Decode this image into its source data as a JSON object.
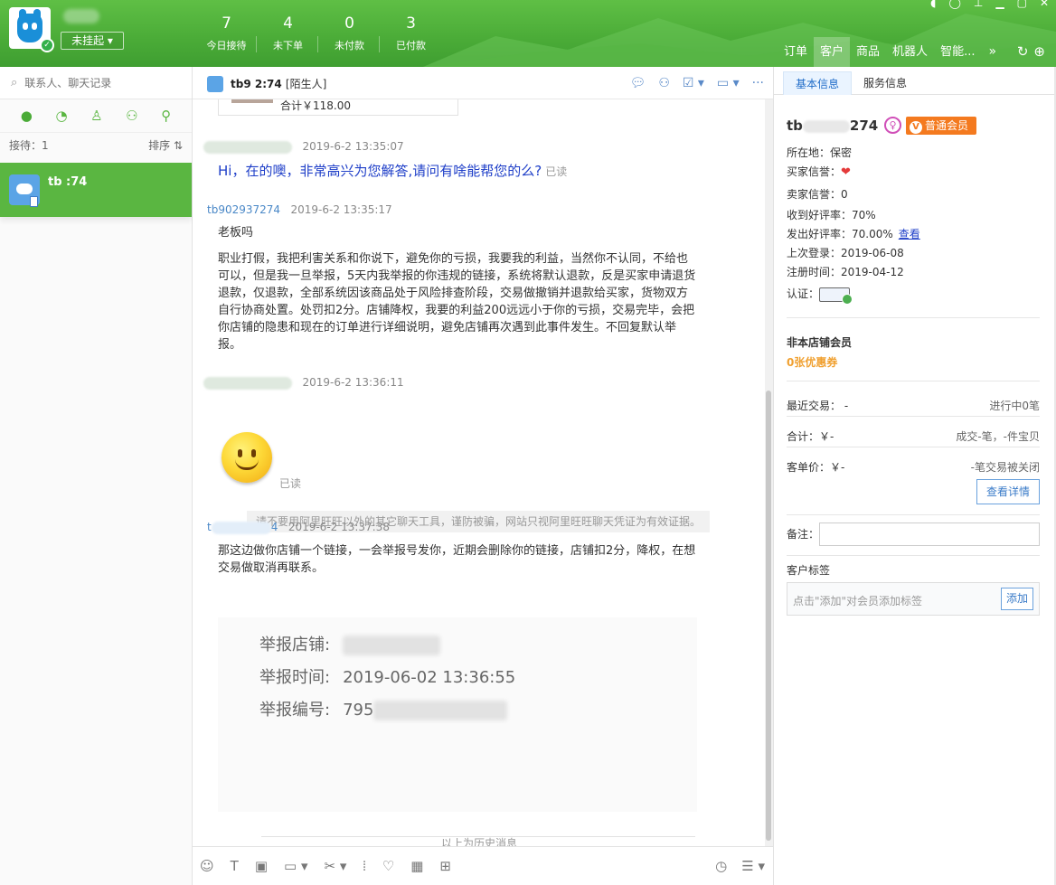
{
  "header": {
    "status": "未挂起",
    "stats": [
      {
        "num": "7",
        "label": "今日接待"
      },
      {
        "num": "4",
        "label": "未下单"
      },
      {
        "num": "0",
        "label": "未付款"
      },
      {
        "num": "3",
        "label": "已付款"
      }
    ],
    "nav_tabs": [
      "订单",
      "客户",
      "商品",
      "机器人",
      "智能..."
    ],
    "nav_more": "»"
  },
  "left": {
    "search_placeholder": "联系人、聊天记录",
    "reception_label": "接待：1",
    "sort_label": "排序 ⇅",
    "contact_name": "tb          :74"
  },
  "chat": {
    "header_name": "tb9        2:74",
    "header_tag": "[陌生人]",
    "order_total": "合计￥118.00",
    "messages": {
      "m1_time": "2019-6-2 13:35:07",
      "m1_text": "Hi，在的噢，非常高兴为您解答,请问有啥能帮您的么?",
      "read": "已读",
      "m2_sender": "tb902937274",
      "m2_time": "2019-6-2 13:35:17",
      "m2_text1": "老板吗",
      "m2_text2": "职业打假，我把利害关系和你说下，避免你的亏损，我要我的利益，当然你不认同，不给也可以，但是我一旦举报，5天内我举报的你违规的链接，系统将默认退款，反是买家申请退货退款，仅退款，全部系统因该商品处于风险排查阶段，交易做撤销并退款给买家，货物双方自行协商处置。处罚扣2分。店铺降权，我要的利益200远远小于你的亏损，交易完毕，会把你店铺的隐患和现在的订单进行详细说明，避免店铺再次遇到此事件发生。不回复默认举报。",
      "m3_time": "2019-6-2 13:36:11",
      "notice": "请不要用阿里旺旺以外的其它聊天工具，谨防被骗，网站只视阿里旺旺聊天凭证为有效证据。",
      "m4_sender_start": "t",
      "m4_sender_end": "4",
      "m4_time": "2019-6-2 13:37:38",
      "m4_text": "那这边做你店铺一个链接，一会举报号发你，近期会删除你的链接，店铺扣2分，降权，在想交易做取消再联系。",
      "report_shop_label": "举报店铺:",
      "report_time_label": "举报时间:",
      "report_time_value": "2019-06-02 13:36:55",
      "report_no_label": "举报编号:",
      "report_no_prefix": "795"
    },
    "history": "以上为历史消息"
  },
  "right": {
    "tabs": [
      "基本信息",
      "服务信息"
    ],
    "cust_name_start": "tb",
    "cust_name_end": "274",
    "member_badge": "普通会员",
    "location": "所在地：保密",
    "buyer_credit": "买家信誉：",
    "seller_credit": "卖家信誉：0",
    "received_good": "收到好评率：70%",
    "sent_good": "发出好评率：70.00%",
    "view_link": "查看",
    "last_login": "上次登录：2019-06-08",
    "register_time": "注册时间：2019-04-12",
    "auth": "认证：",
    "non_member": "非本店铺会员",
    "coupons": "0张优惠券",
    "recent_trade": "最近交易：  -",
    "in_progress": "进行中0笔",
    "total": "合计：￥-",
    "deal": "成交-笔，-件宝贝",
    "unit_price": "客单价：￥-",
    "closed": "-笔交易被关闭",
    "detail_btn": "查看详情",
    "remark_label": "备注：",
    "tag_title": "客户标签",
    "tag_placeholder": "点击\"添加\"对会员添加标签",
    "tag_add": "添加"
  }
}
